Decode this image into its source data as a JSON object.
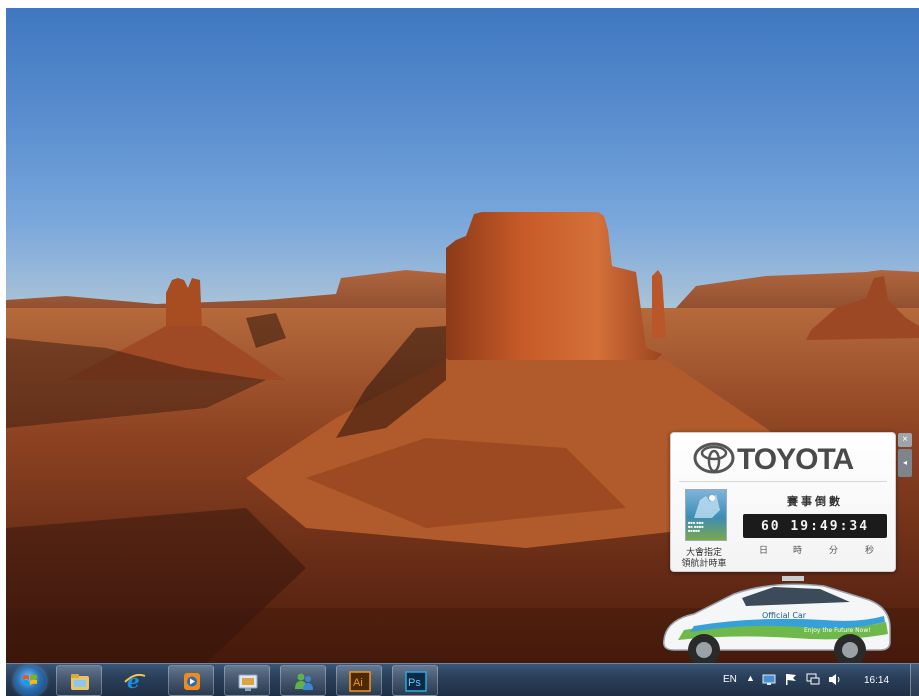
{
  "desktop": {
    "wallpaper": "Desert landscape with red rock buttes (Monument Valley)"
  },
  "gadget": {
    "brand": "TOYOTA",
    "sponsor_caption": [
      "大會指定",
      "領航計時車"
    ],
    "countdown": {
      "title": "賽事倒數",
      "value": "60 19:49:34",
      "days": "60",
      "hours": "19",
      "minutes": "49",
      "seconds": "34",
      "labels": {
        "days": "日",
        "hours": "時",
        "minutes": "分",
        "seconds": "秒"
      }
    },
    "close_glyph": "×",
    "options_glyph": "◂",
    "car_decal": "Official Car",
    "car_slogan": "Enjoy the Future Now!"
  },
  "taskbar": {
    "start": "windows-orb-icon",
    "apps": [
      {
        "name": "windows-explorer-icon"
      },
      {
        "name": "internet-explorer-icon"
      },
      {
        "name": "media-player-icon"
      },
      {
        "name": "gadget-slideshow-icon"
      },
      {
        "name": "windows-live-messenger-icon"
      },
      {
        "name": "illustrator-icon",
        "label": "Ai"
      },
      {
        "name": "photoshop-icon",
        "label": "Ps"
      }
    ],
    "tray": {
      "language": "EN",
      "expand": "▲",
      "clock": "16:14"
    }
  },
  "colors": {
    "taskbar": "#2a3f5a",
    "countdown_bg": "#1b1b1b",
    "illustrator": "#f7931e",
    "photoshop": "#2fa7e0"
  }
}
